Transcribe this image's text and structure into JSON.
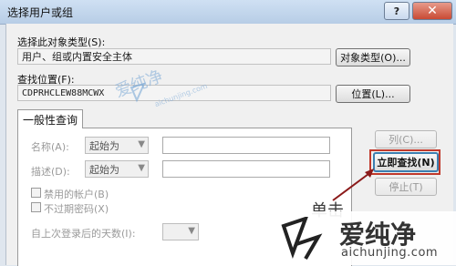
{
  "window": {
    "title": "选择用户或组",
    "help_button": "?",
    "close_button": "✕"
  },
  "object_type": {
    "label": "选择此对象类型(S):",
    "value": "用户、组或内置安全主体",
    "button": "对象类型(O)..."
  },
  "location": {
    "label": "查找位置(F):",
    "value": "CDPRHCLEW88MCWX",
    "button": "位置(L)..."
  },
  "tabs": [
    {
      "label": "一般性查询"
    }
  ],
  "query": {
    "name_label": "名称(A):",
    "name_combo": "起始为",
    "desc_label": "描述(D):",
    "desc_combo": "起始为",
    "disabled_accounts": "禁用的帐户(B)",
    "no_expire_password": "不过期密码(X)",
    "days_label": "自上次登录后的天数(I):"
  },
  "side_buttons": {
    "columns": "列(C)...",
    "find_now": "立即查找(N)",
    "stop": "停止(T)"
  },
  "annotation": {
    "text": "单击",
    "highlight_color": "#c0392b"
  },
  "watermarks": {
    "center_text": "爱纯净",
    "center_url": "aichunjing.com",
    "corner_text": "爱纯净",
    "corner_url": "aichunjing.com"
  },
  "colors": {
    "titlebar": "#b7cde6",
    "dialog_bg": "#f0f0f0",
    "primary_border": "#3c7fb1"
  }
}
